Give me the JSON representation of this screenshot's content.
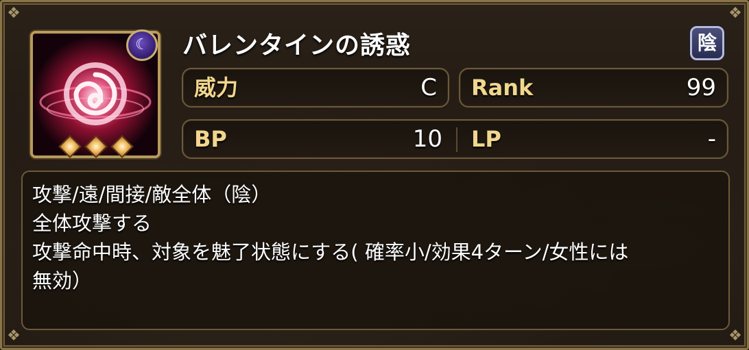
{
  "skill": {
    "name": "バレンタインの誘惑",
    "element_badge": "陰",
    "moon_badge_icon": "crescent-moon-icon",
    "rarity_diamonds": 3
  },
  "stats": {
    "power_label": "威力",
    "power_value": "C",
    "rank_label": "Rank",
    "rank_value": "99",
    "bp_label": "BP",
    "bp_value": "10",
    "lp_label": "LP",
    "lp_value": "-"
  },
  "description": {
    "lines": [
      "攻撃/遠/間接/敵全体（陰）",
      "全体攻撃する",
      "攻撃命中時、対象を魅了状態にする( 確率小/効果4ターン/女性には",
      "無効）"
    ]
  },
  "colors": {
    "label_gold": "#f1d68e",
    "frame_gold": "#8a7548",
    "background": "#221a13"
  }
}
